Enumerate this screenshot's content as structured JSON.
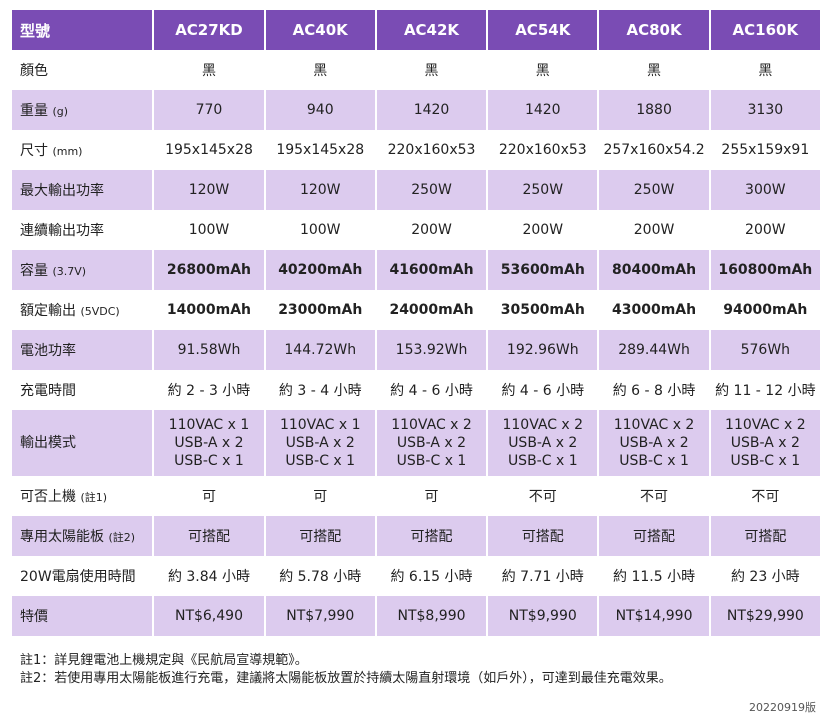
{
  "header": {
    "label": "型號",
    "models": [
      "AC27KD",
      "AC40K",
      "AC42K",
      "AC54K",
      "AC80K",
      "AC160K"
    ]
  },
  "rows": [
    {
      "label": "顏色",
      "unit": "",
      "shaded": false,
      "style": "normal",
      "values": [
        "黑",
        "黑",
        "黑",
        "黑",
        "黑",
        "黑"
      ]
    },
    {
      "label": "重量",
      "unit": "(g)",
      "shaded": true,
      "style": "normal",
      "values": [
        "770",
        "940",
        "1420",
        "1420",
        "1880",
        "3130"
      ]
    },
    {
      "label": "尺寸",
      "unit": "(mm)",
      "shaded": false,
      "style": "normal",
      "values": [
        "195x145x28",
        "195x145x28",
        "220x160x53",
        "220x160x53",
        "257x160x54.2",
        "255x159x91"
      ]
    },
    {
      "label": "最大輸出功率",
      "unit": "",
      "shaded": true,
      "style": "normal",
      "values": [
        "120W",
        "120W",
        "250W",
        "250W",
        "250W",
        "300W"
      ]
    },
    {
      "label": "連續輸出功率",
      "unit": "",
      "shaded": false,
      "style": "normal",
      "values": [
        "100W",
        "100W",
        "200W",
        "200W",
        "200W",
        "200W"
      ]
    },
    {
      "label": "容量",
      "unit": "(3.7V)",
      "shaded": true,
      "style": "bold",
      "values": [
        "26800mAh",
        "40200mAh",
        "41600mAh",
        "53600mAh",
        "80400mAh",
        "160800mAh"
      ]
    },
    {
      "label": "額定輸出",
      "unit": "(5VDC)",
      "shaded": false,
      "style": "bold",
      "values": [
        "14000mAh",
        "23000mAh",
        "24000mAh",
        "30500mAh",
        "43000mAh",
        "94000mAh"
      ]
    },
    {
      "label": "電池功率",
      "unit": "",
      "shaded": true,
      "style": "large",
      "values": [
        "91.58Wh",
        "144.72Wh",
        "153.92Wh",
        "192.96Wh",
        "289.44Wh",
        "576Wh"
      ]
    },
    {
      "label": "充電時間",
      "unit": "",
      "shaded": false,
      "style": "normal",
      "values": [
        "約 2 - 3 小時",
        "約 3 - 4 小時",
        "約 4 - 6 小時",
        "約 4 - 6 小時",
        "約 6 - 8 小時",
        "約 11 - 12 小時"
      ]
    },
    {
      "label": "輸出模式",
      "unit": "",
      "shaded": true,
      "style": "multi",
      "values": [
        [
          "110VAC x 1",
          "USB-A x 2",
          "USB-C x 1"
        ],
        [
          "110VAC x 1",
          "USB-A x 2",
          "USB-C x 1"
        ],
        [
          "110VAC x 2",
          "USB-A x 2",
          "USB-C x 1"
        ],
        [
          "110VAC x 2",
          "USB-A x 2",
          "USB-C x 1"
        ],
        [
          "110VAC x 2",
          "USB-A x 2",
          "USB-C x 1"
        ],
        [
          "110VAC x 2",
          "USB-A x 2",
          "USB-C x 1"
        ]
      ]
    },
    {
      "label": "可否上機",
      "unit": "(註1)",
      "shaded": false,
      "style": "normal",
      "values": [
        "可",
        "可",
        "可",
        "不可",
        "不可",
        "不可"
      ]
    },
    {
      "label": "專用太陽能板",
      "unit": "(註2)",
      "shaded": true,
      "style": "normal",
      "values": [
        "可搭配",
        "可搭配",
        "可搭配",
        "可搭配",
        "可搭配",
        "可搭配"
      ]
    },
    {
      "label": "20W電扇使用時間",
      "unit": "",
      "shaded": false,
      "style": "normal",
      "values": [
        "約 3.84 小時",
        "約 5.78 小時",
        "約 6.15 小時",
        "約 7.71 小時",
        "約 11.5 小時",
        "約 23 小時"
      ]
    },
    {
      "label": "特價",
      "unit": "",
      "shaded": true,
      "style": "large",
      "values": [
        "NT$6,490",
        "NT$7,990",
        "NT$8,990",
        "NT$9,990",
        "NT$14,990",
        "NT$29,990"
      ]
    }
  ],
  "notes": [
    "註1：詳見鋰電池上機規定與《民航局宣導規範》。",
    "註2：若使用專用太陽能板進行充電，建議將太陽能板放置於持續太陽直射環境（如戶外），可達到最佳充電效果。"
  ],
  "version": "20220919版",
  "colors": {
    "header_bg": "#7a4cb4",
    "shaded_row": "#dccbee",
    "plain_row": "#ffffff"
  }
}
